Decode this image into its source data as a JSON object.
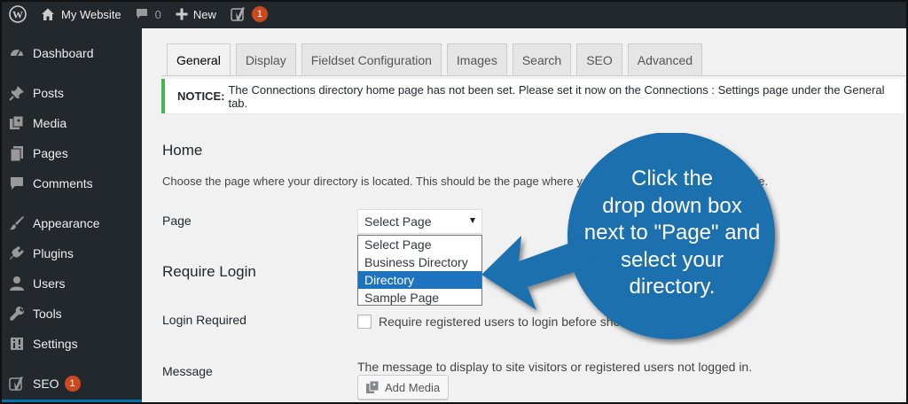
{
  "adminbar": {
    "site_name": "My Website",
    "comments_count": "0",
    "new_label": "New",
    "yoast_badge": "1"
  },
  "sidebar": {
    "items": [
      {
        "label": "Dashboard",
        "icon": "dashboard-icon"
      },
      {
        "label": "Posts",
        "icon": "pin-icon"
      },
      {
        "label": "Media",
        "icon": "media-icon"
      },
      {
        "label": "Pages",
        "icon": "pages-icon"
      },
      {
        "label": "Comments",
        "icon": "comment-icon"
      },
      {
        "label": "Appearance",
        "icon": "brush-icon"
      },
      {
        "label": "Plugins",
        "icon": "plug-icon"
      },
      {
        "label": "Users",
        "icon": "user-icon"
      },
      {
        "label": "Tools",
        "icon": "wrench-icon"
      },
      {
        "label": "Settings",
        "icon": "settings-icon"
      },
      {
        "label": "SEO",
        "icon": "yoast-icon",
        "badge": "1"
      }
    ]
  },
  "tabs": [
    {
      "label": "General",
      "active": true
    },
    {
      "label": "Display"
    },
    {
      "label": "Fieldset Configuration"
    },
    {
      "label": "Images"
    },
    {
      "label": "Search"
    },
    {
      "label": "SEO"
    },
    {
      "label": "Advanced"
    }
  ],
  "notice": {
    "prefix": "NOTICE:",
    "text": "The Connections directory home page has not been set. Please set it now on the Connections : Settings page under the General tab."
  },
  "home": {
    "heading": "Home",
    "description": "Choose the page where your directory is located. This should be the page where you",
    "description_tail": "de.",
    "page_label": "Page",
    "select_value": "Select Page",
    "options": [
      "Select Page",
      "Business Directory",
      "Directory",
      "Sample Page"
    ],
    "highlighted_option": "Directory"
  },
  "require_login": {
    "heading": "Require Login",
    "login_label": "Login Required",
    "checkbox_text": "Require registered users to login before show",
    "checkbox_text_tail": "y."
  },
  "message": {
    "label": "Message",
    "description": "The message to display to site visitors or registered users not logged in.",
    "add_media_label": "Add Media"
  },
  "callout": {
    "lines": [
      "Click the",
      "drop down box",
      "next to \"Page\" and",
      "select your",
      "directory."
    ],
    "color": "#1a6fad"
  },
  "colors": {
    "adminbar_bg": "#23282d",
    "notice_border": "#46b450",
    "selected_option": "#1e73be",
    "badge": "#ca4a1f"
  }
}
